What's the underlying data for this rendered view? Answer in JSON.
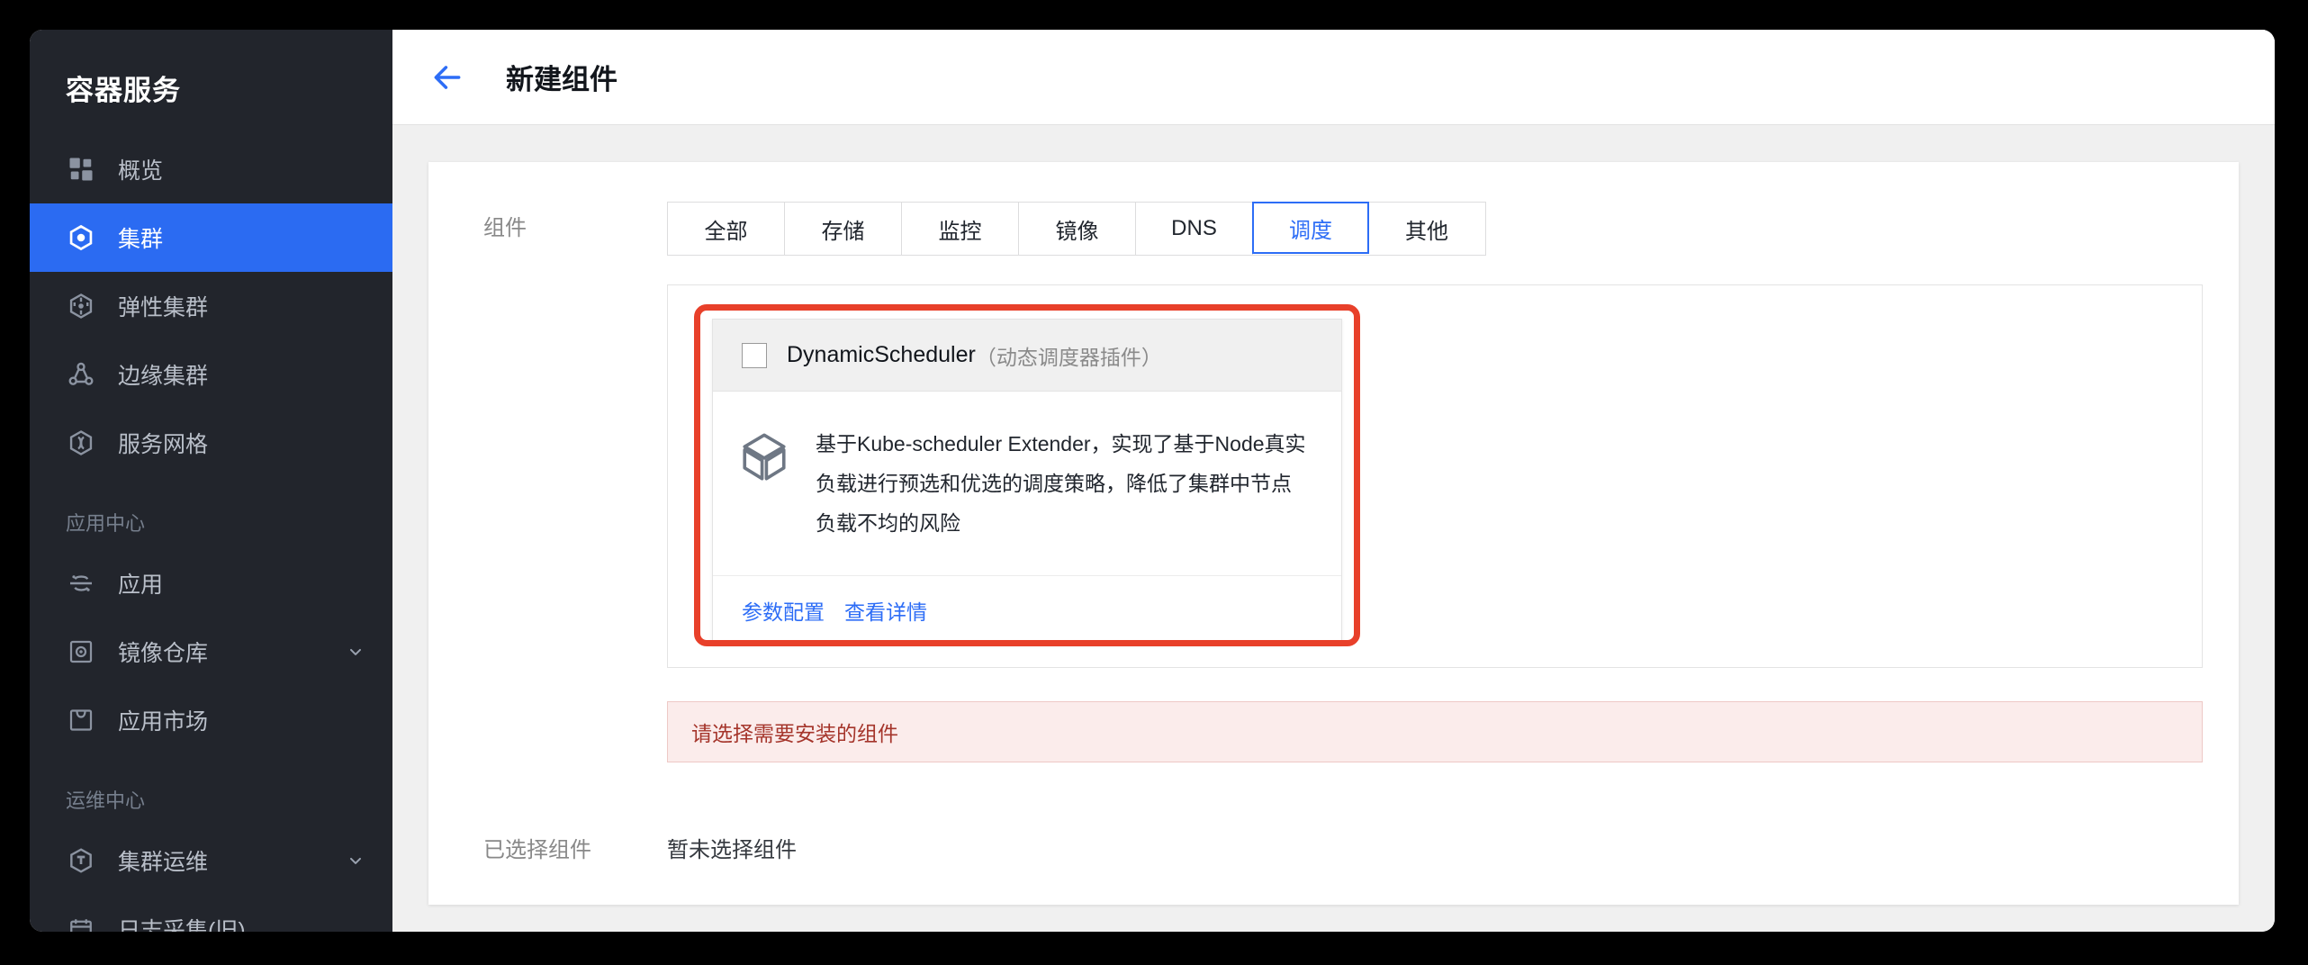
{
  "sidebar": {
    "brand": "容器服务",
    "items": [
      {
        "label": "概览",
        "icon": "grid-icon",
        "active": false,
        "expandable": false,
        "group": null
      },
      {
        "label": "集群",
        "icon": "cluster-icon",
        "active": true,
        "expandable": false,
        "group": null
      },
      {
        "label": "弹性集群",
        "icon": "elastic-cluster-icon",
        "active": false,
        "expandable": false,
        "group": null
      },
      {
        "label": "边缘集群",
        "icon": "edge-cluster-icon",
        "active": false,
        "expandable": false,
        "group": null
      },
      {
        "label": "服务网格",
        "icon": "service-mesh-icon",
        "active": false,
        "expandable": false,
        "group": null
      }
    ],
    "group_app_center": "应用中心",
    "app_items": [
      {
        "label": "应用",
        "icon": "application-icon",
        "expandable": false
      },
      {
        "label": "镜像仓库",
        "icon": "image-registry-icon",
        "expandable": true
      },
      {
        "label": "应用市场",
        "icon": "app-market-icon",
        "expandable": false
      }
    ],
    "group_ops_center": "运维中心",
    "ops_items": [
      {
        "label": "集群运维",
        "icon": "cluster-ops-icon",
        "expandable": true
      },
      {
        "label": "日志采集(旧)",
        "icon": "log-collection-icon",
        "expandable": false
      }
    ]
  },
  "topbar": {
    "back_icon": "arrow-left-icon",
    "title": "新建组件"
  },
  "form": {
    "component_label": "组件",
    "tabs": [
      {
        "label": "全部",
        "selected": false
      },
      {
        "label": "存储",
        "selected": false
      },
      {
        "label": "监控",
        "selected": false
      },
      {
        "label": "镜像",
        "selected": false
      },
      {
        "label": "DNS",
        "selected": false
      },
      {
        "label": "调度",
        "selected": true
      },
      {
        "label": "其他",
        "selected": false
      }
    ],
    "component_card": {
      "checkbox_checked": false,
      "name": "DynamicScheduler",
      "name_cn": "（动态调度器插件）",
      "icon": "cube-box-icon",
      "description": "基于Kube-scheduler Extender，实现了基于Node真实负载进行预选和优选的调度策略，降低了集群中节点负载不均的风险",
      "links": [
        {
          "label": "参数配置"
        },
        {
          "label": "查看详情"
        }
      ]
    },
    "error_message": "请选择需要安装的组件",
    "selected_label": "已选择组件",
    "selected_value": "暂未选择组件"
  },
  "colors": {
    "accent_blue": "#2d6df6",
    "sidebar_bg": "#22252c",
    "active_blue": "#2b6bf2",
    "highlight_red": "#e8402a",
    "error_text": "#a5352b",
    "error_bg": "#fbeceb"
  }
}
